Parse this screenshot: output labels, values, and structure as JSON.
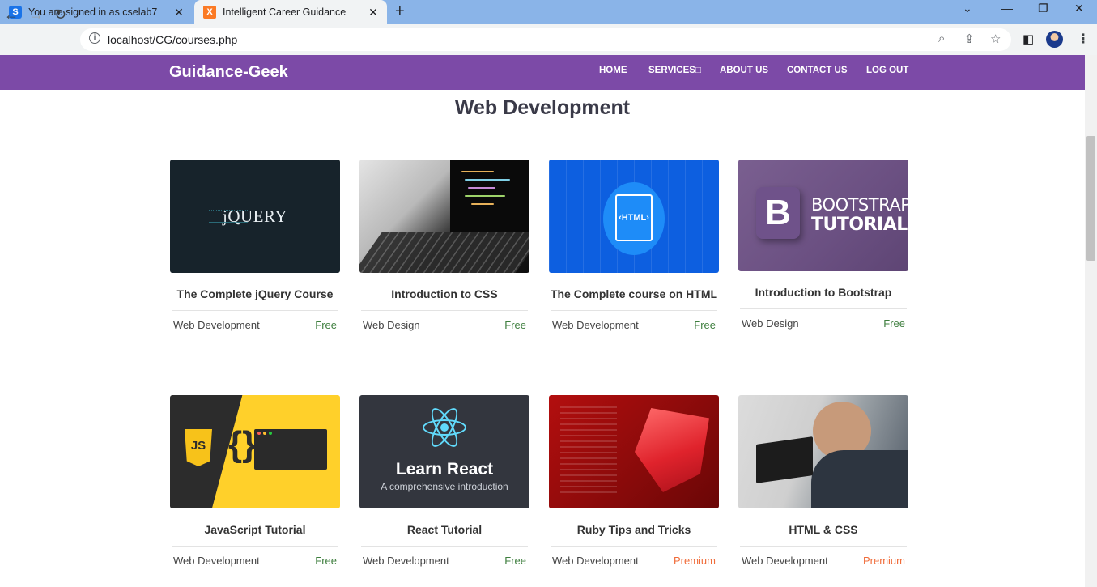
{
  "browser": {
    "tabs": [
      {
        "title": "You are signed in as cselab7",
        "favicon": "S"
      },
      {
        "title": "Intelligent Career Guidance",
        "favicon": "X"
      }
    ],
    "url": "localhost/CG/courses.php"
  },
  "site": {
    "brand": "Guidance-Geek",
    "nav": {
      "home": "HOME",
      "services": "SERVICES□",
      "about": "ABOUT US",
      "contact": "CONTACT US",
      "logout": "LOG OUT"
    },
    "accent_color": "#7c4aa7"
  },
  "section_title": "Web Development",
  "courses": [
    {
      "title": "The Complete jQuery Course",
      "category": "Web Development",
      "price": "Free",
      "thumb_text": "jQUERY"
    },
    {
      "title": "Introduction to CSS",
      "category": "Web Design",
      "price": "Free"
    },
    {
      "title": "The Complete course on HTML",
      "category": "Web Development",
      "price": "Free",
      "thumb_text": "‹HTML›"
    },
    {
      "title": "Introduction to Bootstrap",
      "category": "Web Design",
      "price": "Free",
      "thumb_text": [
        "B",
        "BOOTSTRAP",
        "TUTORIAL"
      ]
    },
    {
      "title": "JavaScript Tutorial",
      "category": "Web Development",
      "price": "Free",
      "thumb_text": "JS"
    },
    {
      "title": "React Tutorial",
      "category": "Web Development",
      "price": "Free",
      "thumb_text": [
        "Learn React",
        "A comprehensive introduction"
      ]
    },
    {
      "title": "Ruby Tips and Tricks",
      "category": "Web Development",
      "price": "Premium"
    },
    {
      "title": "HTML & CSS",
      "category": "Web Development",
      "price": "Premium"
    }
  ],
  "price_colors": {
    "free": "#3f7f3f",
    "premium": "#f06c3a"
  }
}
